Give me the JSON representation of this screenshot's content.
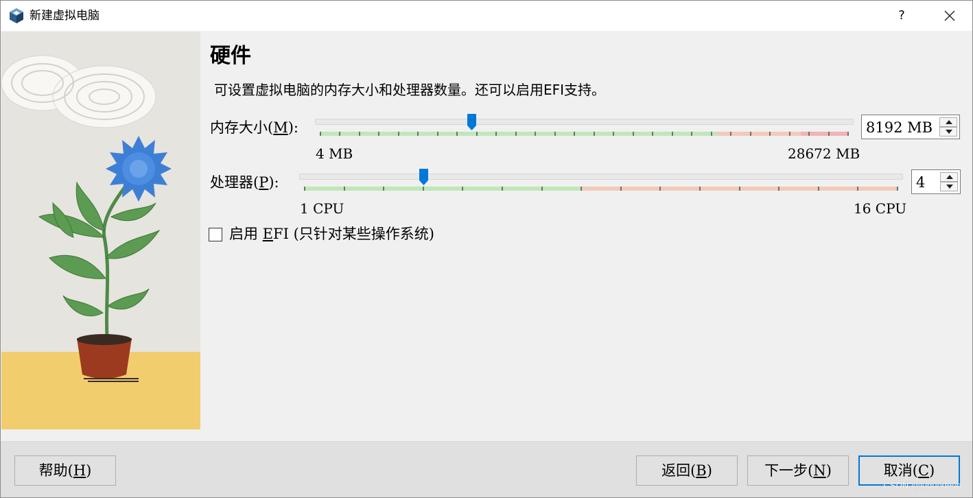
{
  "window": {
    "title": "新建虚拟电脑",
    "help_glyph": "?",
    "icon": "virtualbox-icon"
  },
  "page": {
    "heading": "硬件",
    "description": "可设置虚拟电脑的内存大小和处理器数量。还可以启用EFI支持。"
  },
  "memory": {
    "label_prefix": "内存大小(",
    "label_key": "M",
    "label_suffix": "):",
    "min_label": "4 MB",
    "max_label": "28672 MB",
    "value": "8192 MB",
    "min": 4,
    "max": 28672,
    "current": 8192,
    "colors": {
      "ok": "#bfe8b8",
      "warn": "#f1cbb8",
      "danger": "#f0b4b4"
    }
  },
  "processor": {
    "label_prefix": "处理器(",
    "label_key": "P",
    "label_suffix": "):",
    "min_label": "1 CPU",
    "max_label": "16 CPU",
    "value": "4",
    "min": 1,
    "max": 16,
    "current": 4,
    "colors": {
      "ok": "#bfe8b8",
      "warn": "#f1cbb8"
    }
  },
  "efi": {
    "label_prefix": "启用 ",
    "label_key": "E",
    "label_suffix": "FI (只针对某些操作系统)",
    "checked": false
  },
  "buttons": {
    "help": {
      "prefix": "帮助(",
      "key": "H",
      "suffix": ")"
    },
    "back": {
      "prefix": "返回(",
      "key": "B",
      "suffix": ")"
    },
    "next": {
      "prefix": "下一步(",
      "key": "N",
      "suffix": ")"
    },
    "cancel": {
      "prefix": "取消(",
      "key": "C",
      "suffix": ")"
    }
  },
  "accent_color": "#0078d7",
  "watermark": "CSDN @luguodeyo"
}
